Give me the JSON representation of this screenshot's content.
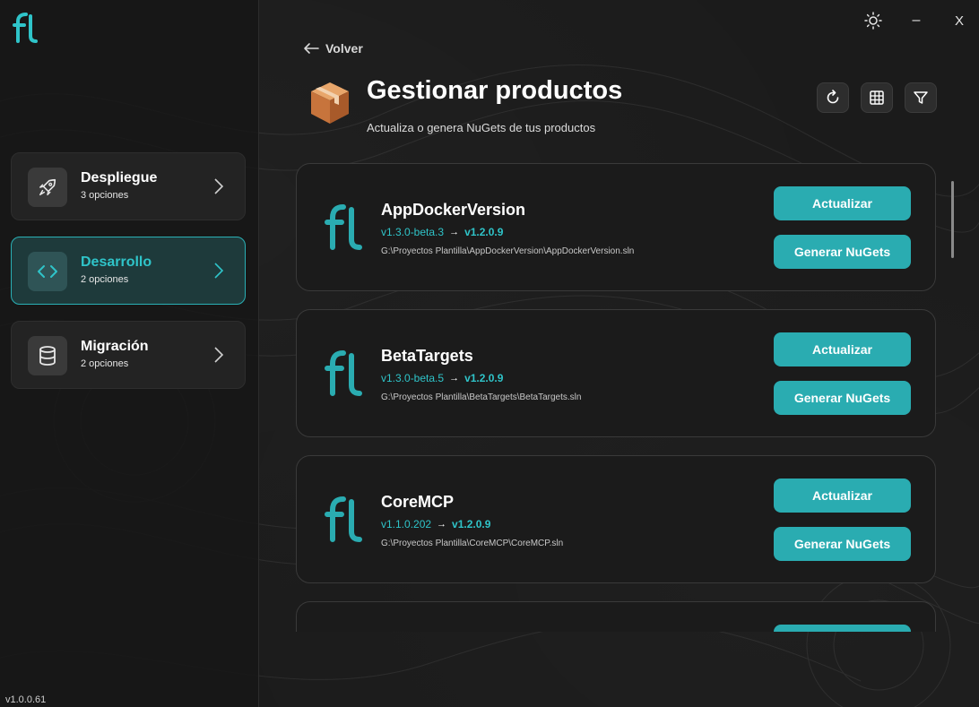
{
  "app": {
    "version": "v1.0.0.61"
  },
  "window_controls": {
    "theme_icon": "sun-icon",
    "minimize_label": "–",
    "close_label": "X"
  },
  "sidebar": {
    "items": [
      {
        "title": "Despliegue",
        "subtitle": "3 opciones",
        "icon": "rocket-icon",
        "active": false
      },
      {
        "title": "Desarrollo",
        "subtitle": "2 opciones",
        "icon": "code-icon",
        "active": true
      },
      {
        "title": "Migración",
        "subtitle": "2 opciones",
        "icon": "database-icon",
        "active": false
      }
    ]
  },
  "header": {
    "back_label": "Volver",
    "title": "Gestionar productos",
    "subtitle": "Actualiza o genera NuGets de tus productos",
    "tools": [
      "refresh-icon",
      "grid-icon",
      "filter-icon"
    ]
  },
  "products": [
    {
      "name": "AppDockerVersion",
      "current_version": "v1.3.0-beta.3",
      "arrow": "→",
      "target_version": "v1.2.0.9",
      "path": "G:\\Proyectos Plantilla\\AppDockerVersion\\AppDockerVersion.sln",
      "update_label": "Actualizar",
      "nuget_label": "Generar NuGets"
    },
    {
      "name": "BetaTargets",
      "current_version": "v1.3.0-beta.5",
      "arrow": "→",
      "target_version": "v1.2.0.9",
      "path": "G:\\Proyectos Plantilla\\BetaTargets\\BetaTargets.sln",
      "update_label": "Actualizar",
      "nuget_label": "Generar NuGets"
    },
    {
      "name": "CoreMCP",
      "current_version": "v1.1.0.202",
      "arrow": "→",
      "target_version": "v1.2.0.9",
      "path": "G:\\Proyectos Plantilla\\CoreMCP\\CoreMCP.sln",
      "update_label": "Actualizar",
      "nuget_label": "Generar NuGets"
    }
  ],
  "colors": {
    "accent": "#2aacb1",
    "accent_text": "#2fc4c9",
    "background": "#1b1b1b"
  }
}
